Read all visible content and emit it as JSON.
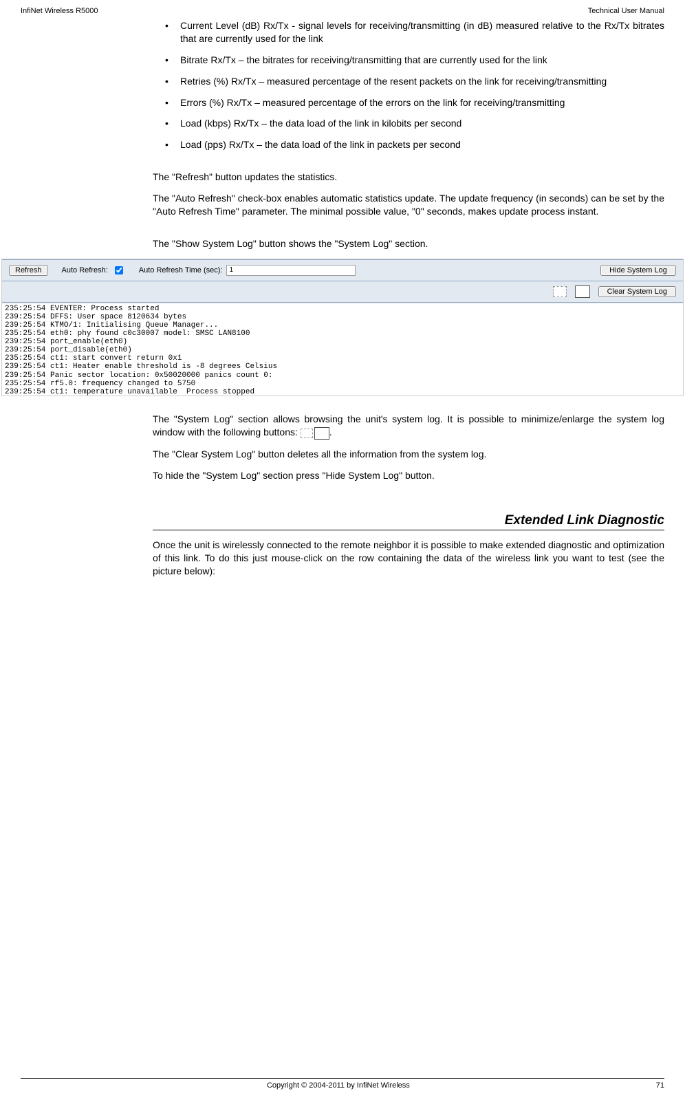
{
  "header": {
    "left": "InfiNet Wireless R5000",
    "right": "Technical User Manual"
  },
  "bullets": [
    "Current Level (dB) Rx/Tx - signal levels for receiving/transmitting (in dB) measured relative to the Rx/Tx bitrates that are currently used for the link",
    "Bitrate Rx/Tx – the bitrates for receiving/transmitting that are currently used for the link",
    "Retries (%) Rx/Tx – measured percentage of the resent packets on the link for receiving/transmitting",
    "Errors (%) Rx/Tx – measured percentage of the errors on the link for receiving/transmitting",
    "Load (kbps) Rx/Tx – the data load of the link in kilobits per second",
    "Load (pps) Rx/Tx – the data load of the link in packets per second"
  ],
  "p1": "The \"Refresh\" button updates the statistics.",
  "p2": "The \"Auto Refresh\" check-box enables automatic statistics update. The update frequency (in seconds) can be set by the \"Auto Refresh Time\" parameter. The minimal possible value, \"0\" seconds, makes update process instant.",
  "p3": "The \"Show System Log\" button shows the \"System Log\" section.",
  "ui": {
    "refresh": "Refresh",
    "auto_refresh": "Auto Refresh:",
    "auto_refresh_time": "Auto Refresh Time (sec):",
    "auto_refresh_time_val": "1",
    "hide_system_log": "Hide System Log",
    "clear_system_log": "Clear System Log"
  },
  "log_lines": "235:25:54 EVENTER: Process started\n239:25:54 DFFS: User space 8120634 bytes\n239:25:54 KTMO/1: Initialising Queue Manager...\n235:25:54 eth0: phy found c0c30007 model: SMSC LAN8100\n239:25:54 port_enable(eth0)\n239:25:54 port_disable(eth0)\n235:25:54 ct1: start convert return 0x1\n239:25:54 ct1: Heater enable threshold is -8 degrees Celsius\n239:25:54 Panic sector location: 0x50020000 panics count 0:\n235:25:54 rf5.0: frequency changed to 5750\n239:25:54 ct1: temperature unavailable  Process stopped",
  "p4a": "The \"System Log\" section allows browsing the unit's system log. It is possible to minimize/enlarge the system log window with the following buttons: ",
  "p4b": ".",
  "p5": "The \"Clear System Log\" button deletes all the information from the system log.",
  "p6": "To hide the \"System Log\" section press \"Hide System Log\" button.",
  "section_title": "Extended Link Diagnostic",
  "p7": "Once the unit is wirelessly connected to the remote neighbor it is possible to make extended diagnostic and optimization of this link. To do this just mouse-click on the row containing the data of the wireless link you want to test (see the picture below):",
  "footer": {
    "copyright": "Copyright © 2004-2011 by InfiNet Wireless",
    "page": "71"
  }
}
